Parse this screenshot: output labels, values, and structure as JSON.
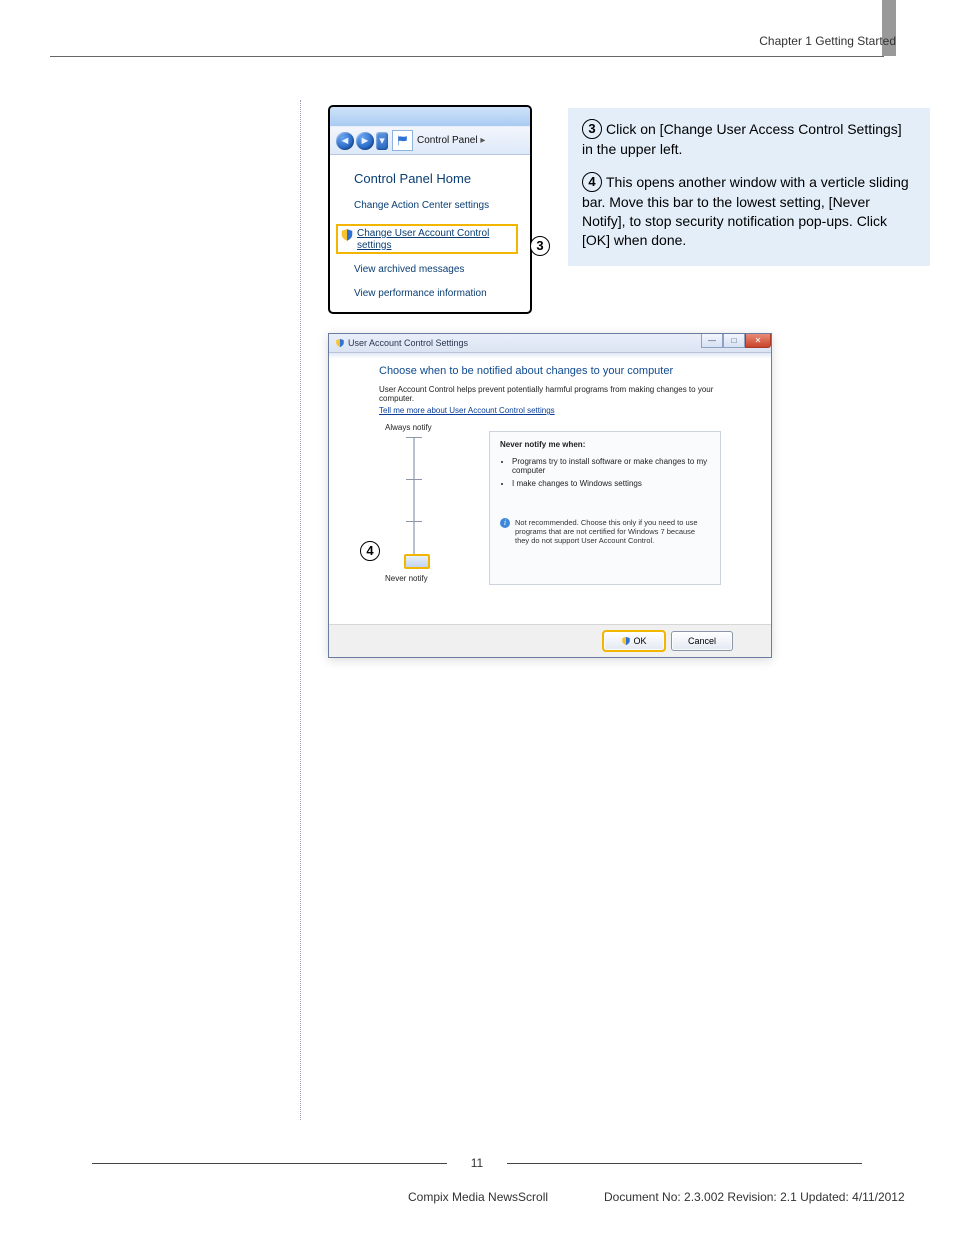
{
  "header": {
    "chapter": "Chapter 1 Getting Started"
  },
  "footer": {
    "page_number": "11",
    "left": "Compix Media NewsScroll",
    "right": "Document No: 2.3.002 Revision: 2.1 Updated: 4/11/2012"
  },
  "callout": {
    "step3_num": "3",
    "step3_text": "Click on [Change User Access Control Settings] in the upper left.",
    "step4_num": "4",
    "step4_text": "This opens another window with a verticle sliding bar. Move this bar to the lowest setting, [Never Notify], to stop security notification pop-ups. Click [OK] when done."
  },
  "shot1": {
    "breadcrumb": "Control Panel",
    "heading": "Control Panel Home",
    "links": {
      "action_center": "Change Action Center settings",
      "uac": "Change User Account Control settings",
      "archived": "View archived messages",
      "perf": "View performance information"
    }
  },
  "annot3": "3",
  "annot4": "4",
  "shot2": {
    "title": "User Account Control Settings",
    "heading": "Choose when to be notified about changes to your computer",
    "subtext": "User Account Control helps prevent potentially harmful programs from making changes to your computer.",
    "more_link": "Tell me more about User Account Control settings",
    "label_top": "Always notify",
    "label_bottom": "Never notify",
    "notify_title": "Never notify me when:",
    "bullet1": "Programs try to install software or make changes to my computer",
    "bullet2": "I make changes to Windows settings",
    "warning": "Not recommended. Choose this only if you need to use programs that are not certified for Windows 7 because they do not support User Account Control.",
    "ok": "OK",
    "cancel": "Cancel"
  }
}
